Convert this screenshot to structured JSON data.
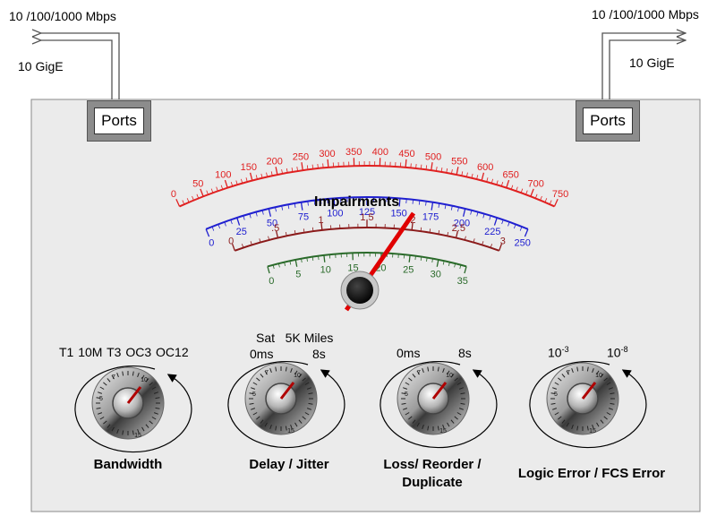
{
  "links": {
    "left": {
      "speed": "10 /100/1000 Mbps",
      "gige": "10 GigE"
    },
    "right": {
      "speed": "10 /100/1000 Mbps",
      "gige": "10 GigE"
    }
  },
  "ports": {
    "left_label": "Ports",
    "right_label": "Ports"
  },
  "meter": {
    "title": "Impairments",
    "scales": [
      {
        "name": "outer-red",
        "color": "#e02020",
        "labels": [
          "0",
          "50",
          "100",
          "150",
          "200",
          "250",
          "300",
          "350",
          "400",
          "450",
          "500",
          "550",
          "600",
          "650",
          "700",
          "750"
        ]
      },
      {
        "name": "blue",
        "color": "#2020d0",
        "labels": [
          "0",
          "25",
          "50",
          "75",
          "100",
          "125",
          "150",
          "175",
          "200",
          "225",
          "250"
        ]
      },
      {
        "name": "dark-red",
        "color": "#8b1a1a",
        "labels": [
          "0",
          ".5",
          "1",
          "1.5",
          "2",
          "2.5",
          "3"
        ]
      },
      {
        "name": "green",
        "color": "#2a6a2a",
        "labels": [
          "0",
          "5",
          "10",
          "15",
          "20",
          "25",
          "30",
          "35"
        ]
      }
    ]
  },
  "knobs": [
    {
      "name": "bandwidth",
      "title": "Bandwidth",
      "top_labels": [
        "T1",
        "10M",
        "T3",
        "OC3",
        "OC12"
      ],
      "dial_numbers": [
        "5",
        "7",
        "10",
        "15"
      ]
    },
    {
      "name": "delay-jitter",
      "title": "Delay / Jitter",
      "top_line1": "Sat   5K Miles",
      "left_label": "0ms",
      "right_label": "8s",
      "dial_numbers": [
        "5",
        "7",
        "10",
        "15"
      ]
    },
    {
      "name": "loss-reorder",
      "title_line1": "Loss/ Reorder /",
      "title_line2": "Duplicate",
      "left_label": "0ms",
      "right_label": "8s",
      "dial_numbers": [
        "5",
        "7",
        "10",
        "15"
      ]
    },
    {
      "name": "logic-error",
      "title": "Logic Error / FCS Error",
      "left_base": "10",
      "left_exp": "-3",
      "right_base": "10",
      "right_exp": "-8",
      "dial_numbers": [
        "5",
        "7",
        "10",
        "15"
      ]
    }
  ],
  "colors": {
    "panel": "#ebebeb",
    "needle": "#e00000",
    "port_frame": "#8c8c8c"
  }
}
